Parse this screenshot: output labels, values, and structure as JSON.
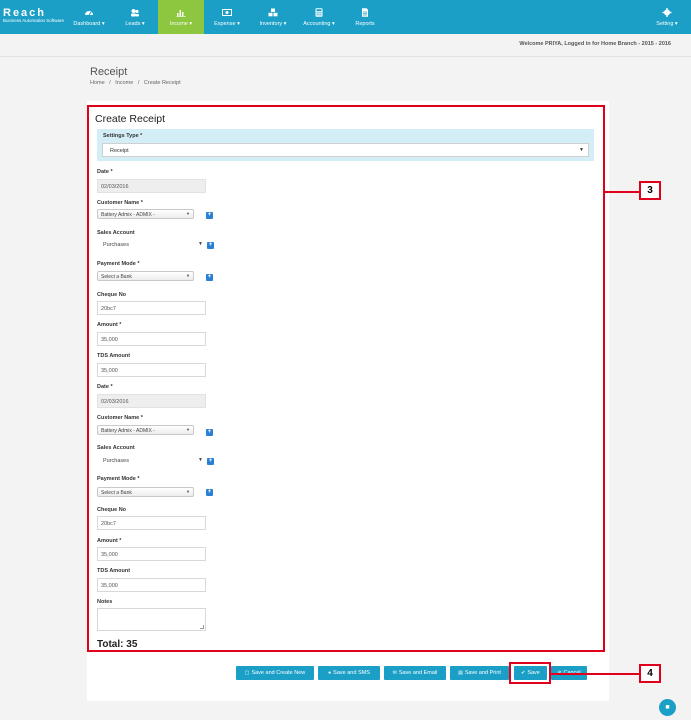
{
  "brand": {
    "name": "Reach",
    "tagline": "Business Automation Software"
  },
  "nav": {
    "items": [
      {
        "label": "Dashboard",
        "icon": "dashboard-icon"
      },
      {
        "label": "Leads",
        "icon": "leads-icon"
      },
      {
        "label": "Income",
        "icon": "bar-chart-icon",
        "active": true
      },
      {
        "label": "Expense",
        "icon": "money-icon"
      },
      {
        "label": "Inventory",
        "icon": "cubes-icon"
      },
      {
        "label": "Accounting",
        "icon": "calculator-icon"
      },
      {
        "label": "Reports",
        "icon": "document-icon"
      }
    ],
    "setting": {
      "label": "Setting",
      "icon": "gear-icon"
    }
  },
  "welcome": "Welcome PRIYA, Logged in for Home Branch - 2015 - 2016",
  "page": {
    "title": "Receipt",
    "breadcrumb": [
      "Home",
      "/",
      "Income",
      "/",
      "Create Receipt"
    ]
  },
  "form": {
    "title": "Create Receipt",
    "settings_type": {
      "label": "Settings Type *",
      "value": "Receipt"
    },
    "block1": {
      "date_label": "Date *",
      "date": "02/03/2016",
      "customer_label": "Customer Name *",
      "customer": "Battery Admix - ADMIX -",
      "sales_label": "Sales Account",
      "sales": "Purchases",
      "payment_label": "Payment Mode *",
      "payment": "Select a Bank",
      "cheque_label": "Cheque No",
      "cheque": "20bc7",
      "amount_label": "Amount *",
      "amount": "35,000",
      "tds_label": "TDS Amount",
      "tds": "35,000"
    },
    "block2": {
      "date_label": "Date *",
      "date": "02/03/2016",
      "customer_label": "Customer Name *",
      "customer": "Battery Admix - ADMIX -",
      "sales_label": "Sales Account",
      "sales": "Purchases",
      "payment_label": "Payment Mode *",
      "payment": "Select a Bank",
      "cheque_label": "Cheque No",
      "cheque": "20bc7",
      "amount_label": "Amount *",
      "amount": "35,000",
      "tds_label": "TDS Amount",
      "tds": "35,000"
    },
    "notes_label": "Notes",
    "total": "Total: 35"
  },
  "buttons": {
    "save_create_new": "Save and Create New",
    "save_sms": "Save and SMS",
    "save_email": "Save and Email",
    "save_print": "Save and Print",
    "save": "Save",
    "cancel": "Cancel"
  },
  "callouts": {
    "form": "3",
    "save": "4"
  },
  "colors": {
    "accent": "#1b9fc6",
    "active_nav": "#8dc63f",
    "highlight": "#e0001b"
  }
}
